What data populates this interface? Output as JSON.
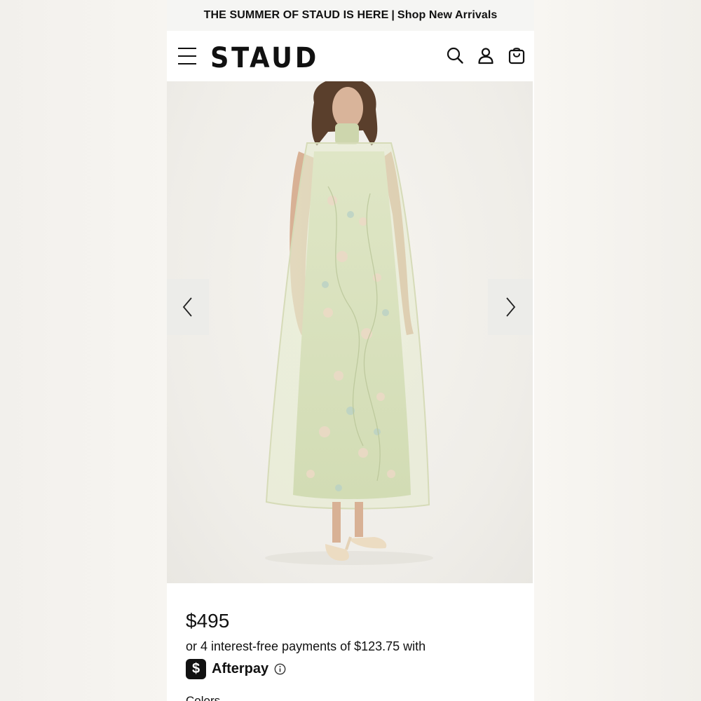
{
  "announcement": {
    "text": "THE SUMMER OF STAUD IS HERE",
    "separator": "|",
    "link": "Shop New Arrivals"
  },
  "header": {
    "brand": "STAUD",
    "icons": [
      "menu-icon",
      "search-icon",
      "account-icon",
      "bag-icon"
    ]
  },
  "gallery": {
    "image_alt": "Model wearing sage green sheer floral embroidered maxi dress",
    "dress_color": "#d9e2be",
    "prev_icon": "chevron-left-icon",
    "next_icon": "chevron-right-icon"
  },
  "product": {
    "price": "$495",
    "installments": "or 4 interest-free payments of $123.75 with",
    "afterpay_symbol": "$",
    "afterpay_name": "Afterpay",
    "colors_label": "Colors"
  }
}
